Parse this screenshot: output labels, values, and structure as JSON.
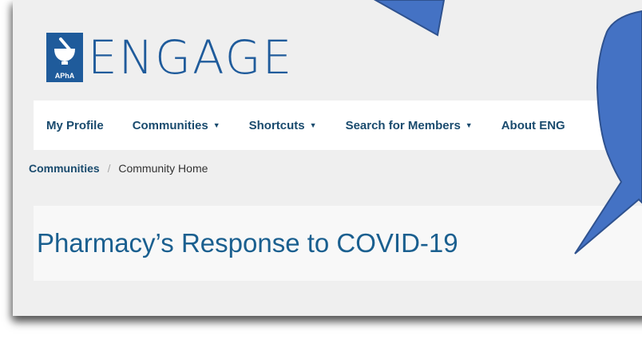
{
  "brand": {
    "mark_label": "APhA",
    "name": "ENGAGE"
  },
  "nav": {
    "items": [
      {
        "label": "My Profile",
        "has_menu": false
      },
      {
        "label": "Communities",
        "has_menu": true
      },
      {
        "label": "Shortcuts",
        "has_menu": true
      },
      {
        "label": "Search for Members",
        "has_menu": true
      },
      {
        "label": "About ENG",
        "has_menu": false
      }
    ],
    "caret_glyph": "▼"
  },
  "breadcrumb": {
    "parent": "Communities",
    "separator": "/",
    "current": "Community Home"
  },
  "page": {
    "title": "Pharmacy’s Response to COVID-19"
  },
  "colors": {
    "brand_blue": "#1f5b9b",
    "nav_text": "#1a4b6e",
    "title_blue": "#1a5f8f",
    "callout_fill": "#4472c4",
    "callout_stroke": "#2f528f"
  }
}
